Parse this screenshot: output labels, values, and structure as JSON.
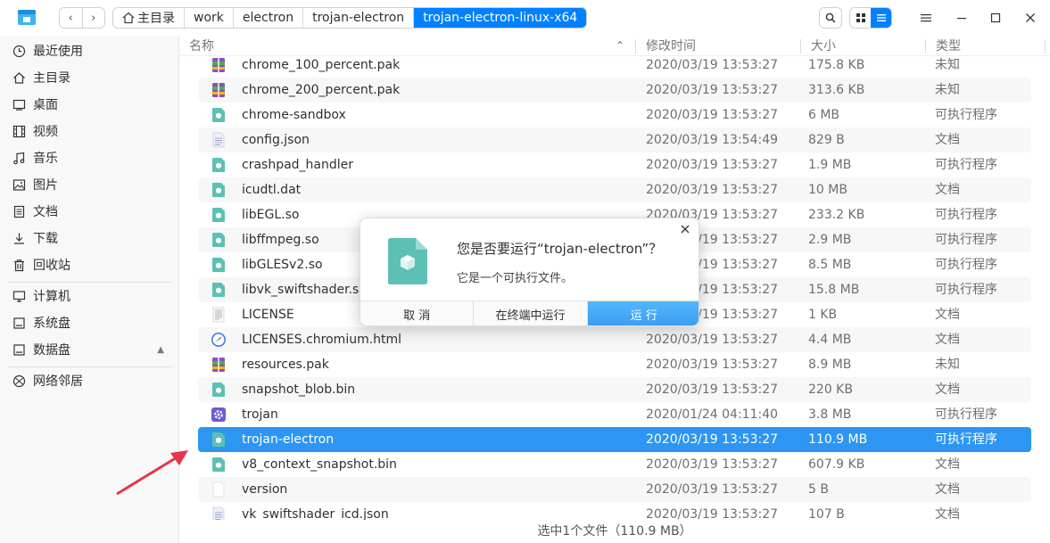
{
  "titlebar": {
    "breadcrumb": [
      "主目录",
      "work",
      "electron",
      "trojan-electron",
      "trojan-electron-linux-x64"
    ],
    "icons": {
      "back": "chevron-left-icon",
      "forward": "chevron-right-icon",
      "search": "search-icon",
      "grid": "grid-view-icon",
      "list": "list-view-icon",
      "menu": "menu-icon",
      "minimize": "minimize-icon",
      "maximize": "maximize-icon",
      "close": "close-icon"
    },
    "accent": "#0081ff"
  },
  "sidebar": {
    "items": [
      {
        "label": "最近使用",
        "icon": "clock-icon"
      },
      {
        "label": "主目录",
        "icon": "home-icon"
      },
      {
        "label": "桌面",
        "icon": "desktop-icon"
      },
      {
        "label": "视频",
        "icon": "video-icon"
      },
      {
        "label": "音乐",
        "icon": "music-icon"
      },
      {
        "label": "图片",
        "icon": "image-icon"
      },
      {
        "label": "文档",
        "icon": "document-icon"
      },
      {
        "label": "下载",
        "icon": "download-icon"
      },
      {
        "label": "回收站",
        "icon": "trash-icon"
      }
    ],
    "devices": [
      {
        "label": "计算机",
        "icon": "computer-icon"
      },
      {
        "label": "系统盘",
        "icon": "disk-icon"
      },
      {
        "label": "数据盘",
        "icon": "disk-icon"
      }
    ],
    "network": {
      "label": "网络邻居",
      "icon": "network-icon"
    }
  },
  "columns": {
    "name": "名称",
    "modified": "修改时间",
    "size": "大小",
    "type": "类型"
  },
  "files": [
    {
      "name": "chrome_100_percent.pak",
      "time": "2020/03/19 13:53:27",
      "size": "175.8 KB",
      "type": "未知",
      "icon": "pak"
    },
    {
      "name": "chrome_200_percent.pak",
      "time": "2020/03/19 13:53:27",
      "size": "313.6 KB",
      "type": "未知",
      "icon": "pak"
    },
    {
      "name": "chrome-sandbox",
      "time": "2020/03/19 13:53:27",
      "size": "6 MB",
      "type": "可执行程序",
      "icon": "exec"
    },
    {
      "name": "config.json",
      "time": "2020/03/19 13:54:49",
      "size": "829 B",
      "type": "文档",
      "icon": "text"
    },
    {
      "name": "crashpad_handler",
      "time": "2020/03/19 13:53:27",
      "size": "1.9 MB",
      "type": "可执行程序",
      "icon": "exec"
    },
    {
      "name": "icudtl.dat",
      "time": "2020/03/19 13:53:27",
      "size": "10 MB",
      "type": "文档",
      "icon": "exec"
    },
    {
      "name": "libEGL.so",
      "time": "2020/03/19 13:53:27",
      "size": "233.2 KB",
      "type": "可执行程序",
      "icon": "exec"
    },
    {
      "name": "libffmpeg.so",
      "time": "2020/03/19 13:53:27",
      "size": "2.9 MB",
      "type": "可执行程序",
      "icon": "exec"
    },
    {
      "name": "libGLESv2.so",
      "time": "2020/03/19 13:53:27",
      "size": "8.5 MB",
      "type": "可执行程序",
      "icon": "exec"
    },
    {
      "name": "libvk_swiftshader.so",
      "time": "2020/03/19 13:53:27",
      "size": "15.8 MB",
      "type": "可执行程序",
      "icon": "exec"
    },
    {
      "name": "LICENSE",
      "time": "2020/03/19 13:53:27",
      "size": "1 KB",
      "type": "文档",
      "icon": "license"
    },
    {
      "name": "LICENSES.chromium.html",
      "time": "2020/03/19 13:53:27",
      "size": "4.4 MB",
      "type": "文档",
      "icon": "html"
    },
    {
      "name": "resources.pak",
      "time": "2020/03/19 13:53:27",
      "size": "8.9 MB",
      "type": "未知",
      "icon": "pak"
    },
    {
      "name": "snapshot_blob.bin",
      "time": "2020/03/19 13:53:27",
      "size": "220 KB",
      "type": "文档",
      "icon": "exec"
    },
    {
      "name": "trojan",
      "time": "2020/01/24 04:11:40",
      "size": "3.8 MB",
      "type": "可执行程序",
      "icon": "gear"
    },
    {
      "name": "trojan-electron",
      "time": "2020/03/19 13:53:27",
      "size": "110.9 MB",
      "type": "可执行程序",
      "icon": "exec",
      "selected": true
    },
    {
      "name": "v8_context_snapshot.bin",
      "time": "2020/03/19 13:53:27",
      "size": "607.9 KB",
      "type": "文档",
      "icon": "exec"
    },
    {
      "name": "version",
      "time": "2020/03/19 13:53:27",
      "size": "5 B",
      "type": "文档",
      "icon": "blank"
    },
    {
      "name": "vk_swiftshader_icd.json",
      "time": "2020/03/19 13:53:27",
      "size": "107 B",
      "type": "文档",
      "icon": "text"
    }
  ],
  "status": "选中1个文件（110.9 MB）",
  "dialog": {
    "title": "您是否要运行“trojan-electron”？",
    "message": "它是一个可执行文件。",
    "buttons": {
      "cancel": "取 消",
      "terminal": "在终端中运行",
      "run": "运 行"
    },
    "icon": "executable-file-icon"
  },
  "colors": {
    "selection": "#2c96f2",
    "dialog_primary": "#3c9bf0",
    "exec_icon": "#4fb8a8",
    "arrow": "#e8334a"
  }
}
